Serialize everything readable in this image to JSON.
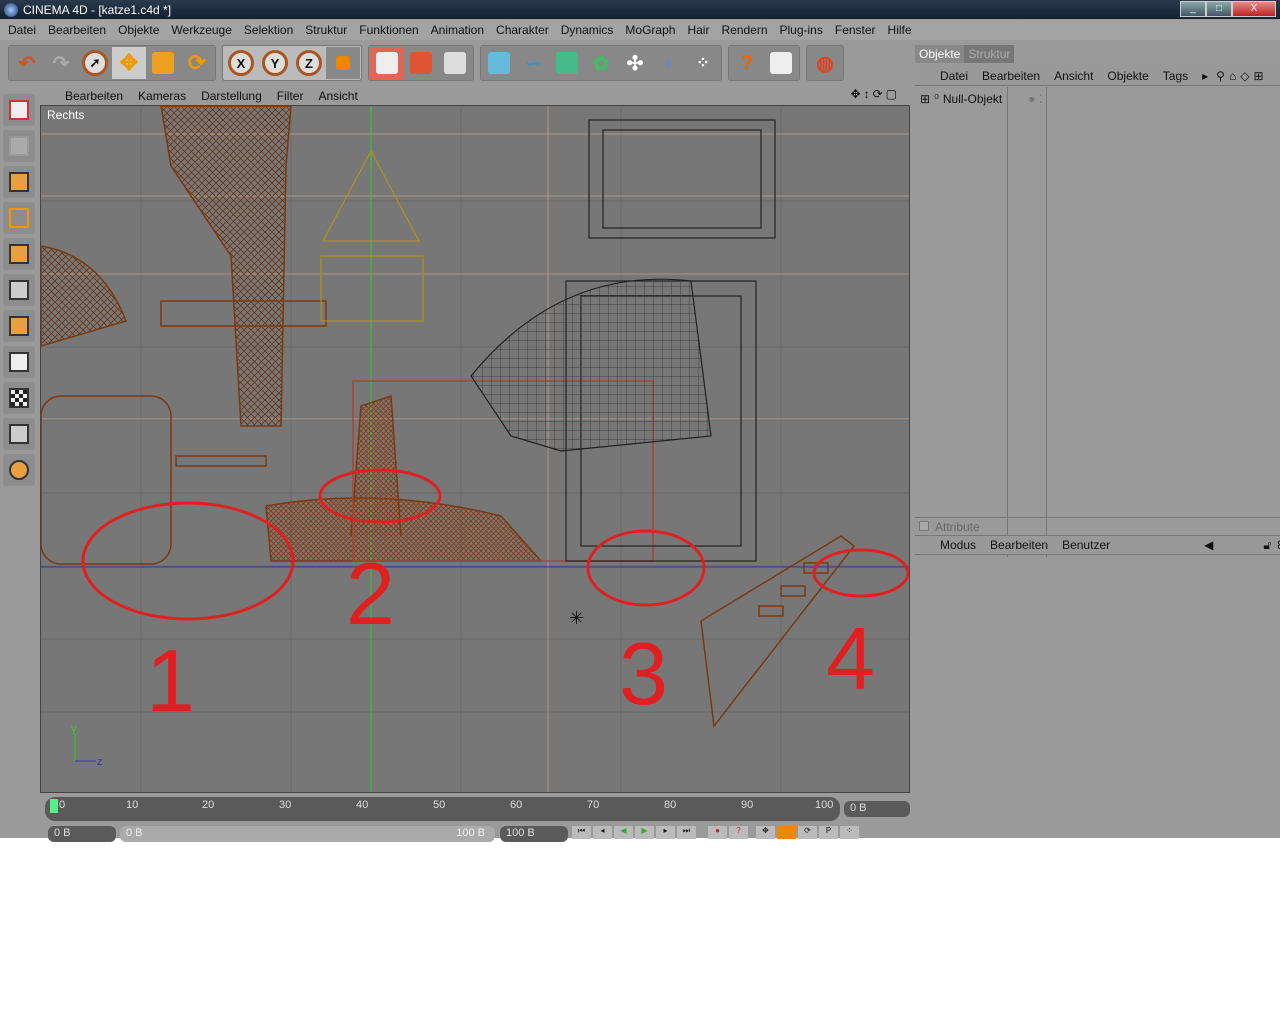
{
  "window": {
    "title": "CINEMA 4D - [katze1.c4d *]",
    "minimize": "_",
    "maximize": "□",
    "close": "X"
  },
  "menubar": [
    "Datei",
    "Bearbeiten",
    "Objekte",
    "Werkzeuge",
    "Selektion",
    "Struktur",
    "Funktionen",
    "Animation",
    "Charakter",
    "Dynamics",
    "MoGraph",
    "Hair",
    "Rendern",
    "Plug-ins",
    "Fenster",
    "Hilfe"
  ],
  "toolbar": {
    "x_label": "X",
    "y_label": "Y",
    "z_label": "Z"
  },
  "viewport": {
    "menu": [
      "Bearbeiten",
      "Kameras",
      "Darstellung",
      "Filter",
      "Ansicht"
    ],
    "view_name": "Rechts",
    "axis_y": "y",
    "axis_z": "z",
    "annotations": [
      "1",
      "2",
      "3",
      "4"
    ],
    "annotation_color": "#e02020"
  },
  "timeline": {
    "ticks": [
      "0",
      "10",
      "20",
      "30",
      "40",
      "50",
      "60",
      "70",
      "80",
      "90",
      "100"
    ],
    "current_frame": "0 B",
    "start": "0 B",
    "range_start": "0 B",
    "range_end": "100 B",
    "end": "100 B"
  },
  "objects_panel": {
    "tabs": [
      "Objekte",
      "Struktur"
    ],
    "menu": [
      "Datei",
      "Bearbeiten",
      "Ansicht",
      "Objekte",
      "Tags"
    ],
    "items": [
      {
        "name": "Null-Objekt"
      }
    ]
  },
  "attributes_panel": {
    "title": "Attribute",
    "menu": [
      "Modus",
      "Bearbeiten",
      "Benutzer"
    ]
  }
}
